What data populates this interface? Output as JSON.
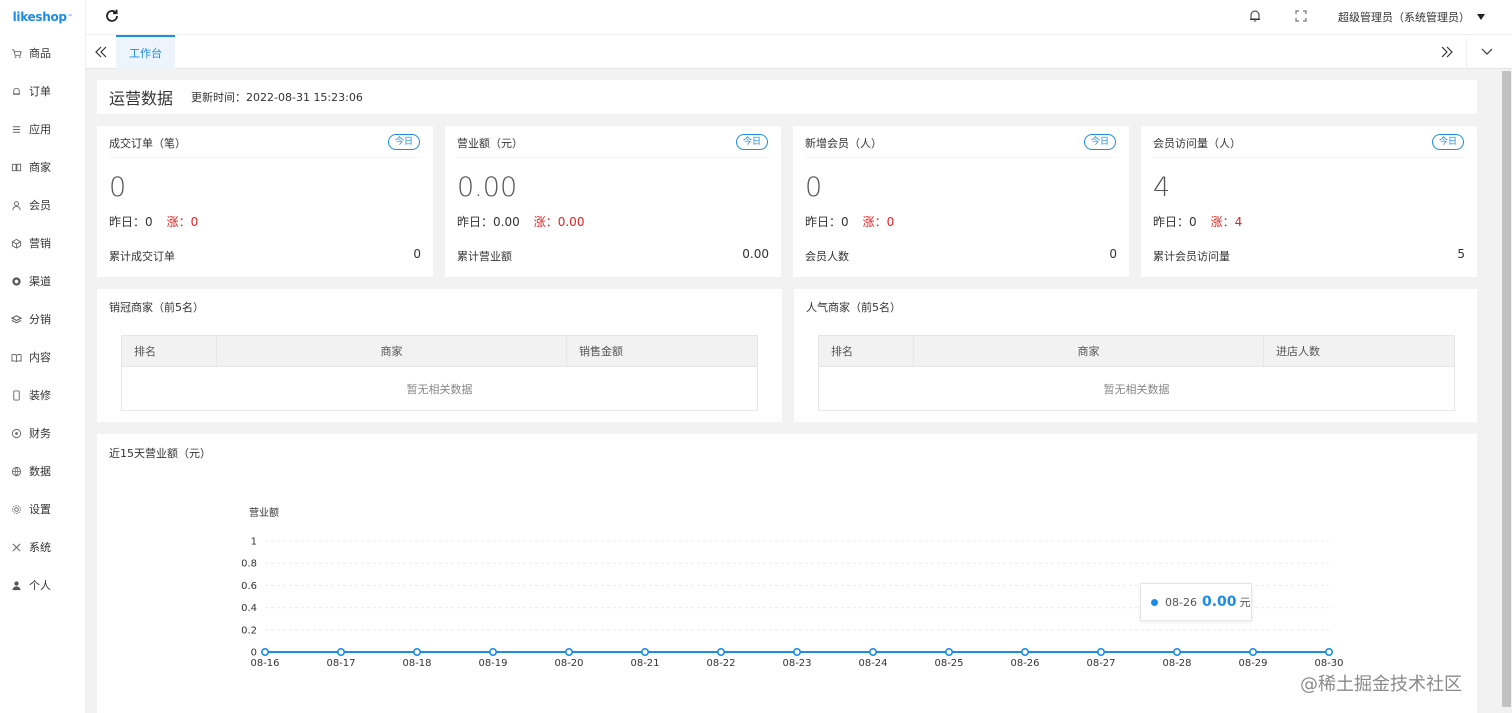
{
  "brand": {
    "name": "likeshop",
    "mark": "™"
  },
  "sidebar": {
    "items": [
      {
        "label": "商品",
        "icon": "cart-icon"
      },
      {
        "label": "订单",
        "icon": "bell-icon"
      },
      {
        "label": "应用",
        "icon": "list-icon"
      },
      {
        "label": "商家",
        "icon": "store-icon"
      },
      {
        "label": "会员",
        "icon": "user-icon"
      },
      {
        "label": "营销",
        "icon": "cube-icon"
      },
      {
        "label": "渠道",
        "icon": "channel-icon"
      },
      {
        "label": "分销",
        "icon": "layers-icon"
      },
      {
        "label": "内容",
        "icon": "book-icon"
      },
      {
        "label": "装修",
        "icon": "phone-icon"
      },
      {
        "label": "财务",
        "icon": "coin-icon"
      },
      {
        "label": "数据",
        "icon": "globe-icon"
      },
      {
        "label": "设置",
        "icon": "gear-icon"
      },
      {
        "label": "系统",
        "icon": "tools-icon"
      },
      {
        "label": "个人",
        "icon": "person-icon"
      }
    ]
  },
  "topbar": {
    "user": "超级管理员（系统管理员）"
  },
  "tabs": {
    "active": "工作台"
  },
  "ops": {
    "title": "运营数据",
    "update_time": "更新时间：2022-08-31 15:23:06"
  },
  "stats": [
    {
      "label": "成交订单（笔）",
      "badge": "今日",
      "value": "0",
      "yesterday": "昨日：0",
      "rise": "涨：0",
      "total_label": "累计成交订单",
      "total_value": "0"
    },
    {
      "label": "营业额（元）",
      "badge": "今日",
      "value": "0.00",
      "yesterday": "昨日：0.00",
      "rise": "涨：0.00",
      "total_label": "累计营业额",
      "total_value": "0.00"
    },
    {
      "label": "新增会员（人）",
      "badge": "今日",
      "value": "0",
      "yesterday": "昨日：0",
      "rise": "涨：0",
      "total_label": "会员人数",
      "total_value": "0"
    },
    {
      "label": "会员访问量（人）",
      "badge": "今日",
      "value": "4",
      "yesterday": "昨日：0",
      "rise": "涨：4",
      "total_label": "累计会员访问量",
      "total_value": "5"
    }
  ],
  "sales_rank": {
    "title": "销冠商家（前5名）",
    "headers": [
      "排名",
      "商家",
      "销售金额"
    ],
    "empty": "暂无相关数据"
  },
  "popular_rank": {
    "title": "人气商家（前5名）",
    "headers": [
      "排名",
      "商家",
      "进店人数"
    ],
    "empty": "暂无相关数据"
  },
  "trend": {
    "title": "近15天营业额（元）"
  },
  "chart_data": {
    "type": "line",
    "ylabel": "营业额",
    "ylim": [
      0,
      1
    ],
    "yticks": [
      "0",
      "0.2",
      "0.4",
      "0.6",
      "0.8",
      "1"
    ],
    "categories": [
      "08-16",
      "08-17",
      "08-18",
      "08-19",
      "08-20",
      "08-21",
      "08-22",
      "08-23",
      "08-24",
      "08-25",
      "08-26",
      "08-27",
      "08-28",
      "08-29",
      "08-30"
    ],
    "series": [
      {
        "values": [
          0,
          0,
          0,
          0,
          0,
          0,
          0,
          0,
          0,
          0,
          0,
          0,
          0,
          0,
          0
        ]
      }
    ],
    "color": "#1b8de5",
    "tooltip": {
      "date": "08-26",
      "value": "0.00",
      "unit": "元"
    }
  },
  "watermark": "@稀土掘金技术社区"
}
